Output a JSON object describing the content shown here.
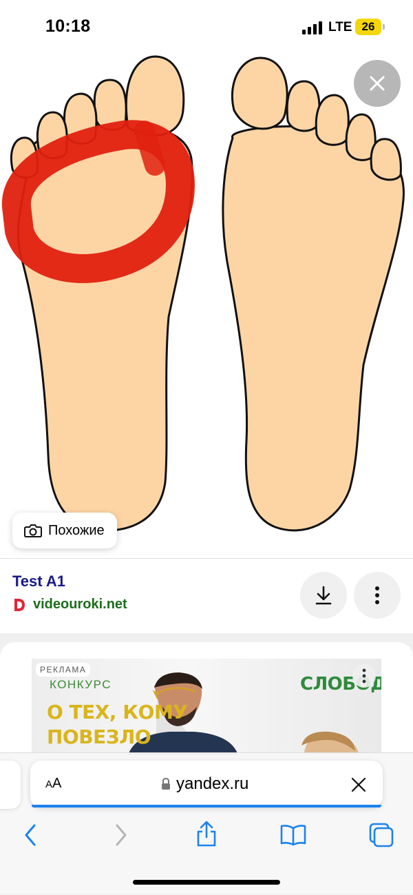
{
  "status_bar": {
    "time": "10:18",
    "network": "LTE",
    "battery": "26"
  },
  "viewer": {
    "similar_label": "Похожие"
  },
  "result": {
    "title": "Test A1",
    "source": "videouroki.net"
  },
  "ad": {
    "badge": "РЕКЛАМА",
    "contest": "КОНКУРС",
    "headline_line1": "О ТЕХ, КОМУ",
    "headline_line2": "ПОВЕЗЛО",
    "brand": "СЛОБОДА"
  },
  "browser": {
    "text_size_small": "A",
    "text_size_large": "A",
    "domain": "yandex.ru"
  },
  "colors": {
    "skin": "#fdd5a5",
    "highlight": "#e0210f",
    "title_link": "#1a1a8a",
    "source_green": "#1b6e1b",
    "accent_blue": "#1a82f0"
  },
  "icons": {
    "close": "close-icon",
    "camera": "camera-search-icon",
    "download": "download-icon",
    "more": "more-vertical-icon",
    "lock": "lock-icon",
    "back": "chevron-left-icon",
    "forward": "chevron-right-icon",
    "share": "share-icon",
    "bookmarks": "book-icon",
    "tabs": "tabs-icon"
  }
}
